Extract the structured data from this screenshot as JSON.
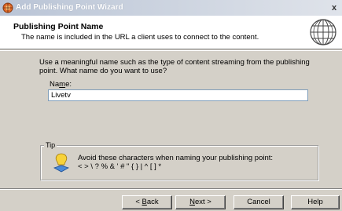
{
  "window": {
    "title": "Add Publishing Point Wizard",
    "close_label": "x"
  },
  "header": {
    "title": "Publishing Point Name",
    "subtitle": "The name is included in the URL a client uses to connect to the content."
  },
  "body": {
    "instruction": "Use a meaningful name such as the type of content streaming from the publishing point. What name do you want to use?",
    "name_label_pre": "Na",
    "name_label_accel": "m",
    "name_label_post": "e:",
    "name_value": "Livetv"
  },
  "tip": {
    "legend": "Tip",
    "line1": "Avoid these characters when naming your publishing point:",
    "line2": "< > \\ ? % & ' # \" { } | ^ [ ] *"
  },
  "buttons": {
    "back_pre": "< ",
    "back_accel": "B",
    "back_post": "ack",
    "next_accel": "N",
    "next_post": "ext >",
    "cancel": "Cancel",
    "help": "Help"
  },
  "icons": {
    "title": "wizard-app-icon",
    "header": "globe-icon",
    "tip": "lightbulb-tip-icon"
  }
}
